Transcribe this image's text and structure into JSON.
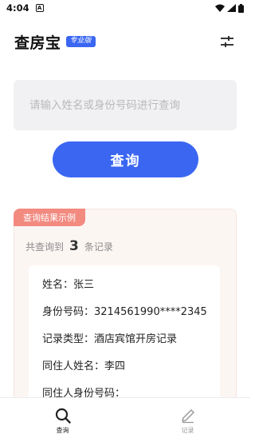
{
  "status_bar": {
    "time": "4:04",
    "notification_glyph": "A"
  },
  "header": {
    "title": "查房宝",
    "badge": "专业版"
  },
  "search": {
    "placeholder": "请输入姓名或身份号码进行查询",
    "value": "",
    "button_label": "查询"
  },
  "result": {
    "tag": "查询结果示例",
    "count_prefix": "共查询到",
    "count": "3",
    "count_suffix": "条记录",
    "record_lines": [
      "姓名：张三",
      "身份号码：3214561990****2345",
      "记录类型：酒店宾馆开房记录",
      "同住人姓名：李四",
      "同住人身份号码："
    ]
  },
  "bottom_nav": [
    {
      "label": "查询",
      "icon": "search-icon",
      "active": true
    },
    {
      "label": "记录",
      "icon": "pencil-icon",
      "active": false
    }
  ],
  "colors": {
    "accent": "#3a66f2",
    "tag": "#f28a80",
    "card_bg": "#fcf6f3"
  }
}
